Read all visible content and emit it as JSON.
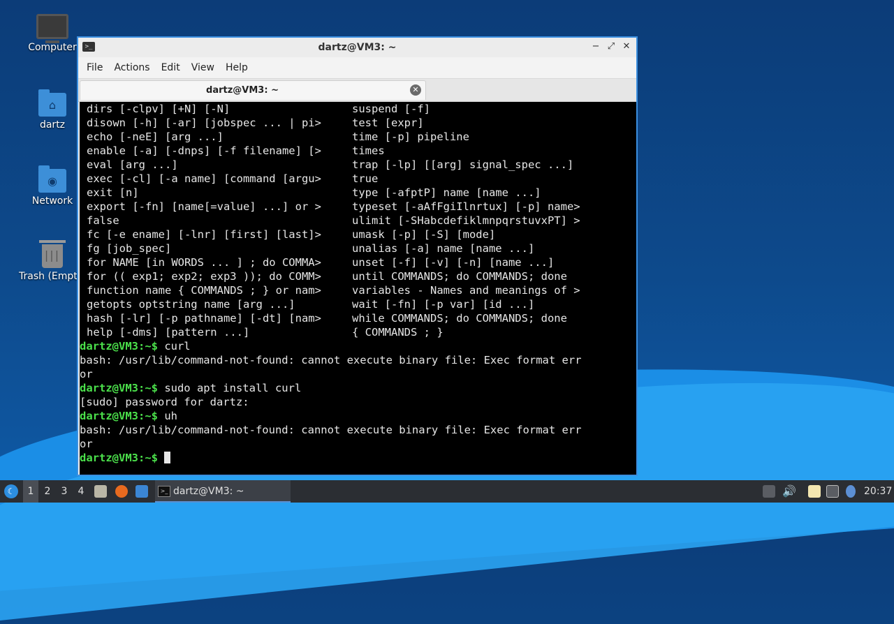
{
  "desktop": {
    "icons": [
      {
        "label": "Computer",
        "icon": "computer-icon"
      },
      {
        "label": "dartz",
        "icon": "home-folder-icon"
      },
      {
        "label": "Network",
        "icon": "network-folder-icon"
      },
      {
        "label": "Trash (Empty)",
        "icon": "trash-icon"
      }
    ]
  },
  "window": {
    "title": "dartz@VM3: ~",
    "controls": {
      "minimize": "−",
      "maximize": "⤢",
      "close": "✕"
    },
    "menu": [
      "File",
      "Actions",
      "Edit",
      "View",
      "Help"
    ],
    "tab": {
      "label": "dartz@VM3: ~",
      "close": "✕"
    }
  },
  "terminal": {
    "help_rows": [
      [
        "dirs [-clpv] [+N] [-N]",
        "suspend [-f]"
      ],
      [
        "disown [-h] [-ar] [jobspec ... | pi>",
        "test [expr]"
      ],
      [
        "echo [-neE] [arg ...]",
        "time [-p] pipeline"
      ],
      [
        "enable [-a] [-dnps] [-f filename] [>",
        "times"
      ],
      [
        "eval [arg ...]",
        "trap [-lp] [[arg] signal_spec ...]"
      ],
      [
        "exec [-cl] [-a name] [command [argu>",
        "true"
      ],
      [
        "exit [n]",
        "type [-afptP] name [name ...]"
      ],
      [
        "export [-fn] [name[=value] ...] or >",
        "typeset [-aAfFgiIlnrtux] [-p] name>"
      ],
      [
        "false",
        "ulimit [-SHabcdefiklmnpqrstuvxPT] >"
      ],
      [
        "fc [-e ename] [-lnr] [first] [last]>",
        "umask [-p] [-S] [mode]"
      ],
      [
        "fg [job_spec]",
        "unalias [-a] name [name ...]"
      ],
      [
        "for NAME [in WORDS ... ] ; do COMMA>",
        "unset [-f] [-v] [-n] [name ...]"
      ],
      [
        "for (( exp1; exp2; exp3 )); do COMM>",
        "until COMMANDS; do COMMANDS; done"
      ],
      [
        "function name { COMMANDS ; } or nam>",
        "variables - Names and meanings of >"
      ],
      [
        "getopts optstring name [arg ...]",
        "wait [-fn] [-p var] [id ...]"
      ],
      [
        "hash [-lr] [-p pathname] [-dt] [nam>",
        "while COMMANDS; do COMMANDS; done"
      ],
      [
        "help [-dms] [pattern ...]",
        "{ COMMANDS ; }"
      ]
    ],
    "prompt": "dartz@VM3:~$",
    "prompt_user": "dartz@VM3:",
    "prompt_path": "~",
    "prompt_sym": "$",
    "cmd1": " curl",
    "err1a": "bash: /usr/lib/command-not-found: cannot execute binary file: Exec format err",
    "err1b": "or",
    "cmd2": " sudo apt install curl",
    "sudo_prompt": "[sudo] password for dartz:",
    "cmd3": " uh",
    "err2a": "bash: /usr/lib/command-not-found: cannot execute binary file: Exec format err",
    "err2b": "or",
    "cmd4": " "
  },
  "taskbar": {
    "workspaces": [
      "1",
      "2",
      "3",
      "4"
    ],
    "active_workspace": "1",
    "task_label": "dartz@VM3: ~",
    "clock": "20:37"
  }
}
